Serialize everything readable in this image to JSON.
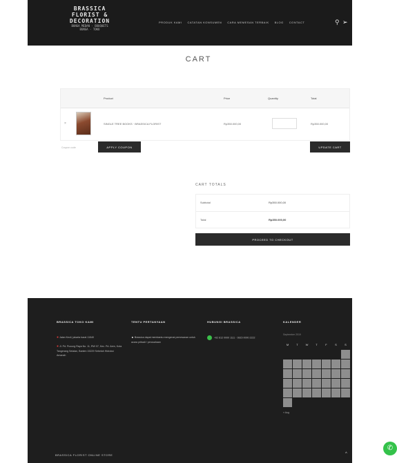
{
  "header": {
    "logo_lines": [
      "BRASSICA",
      "FLORIST &",
      "DECORATION"
    ],
    "logo_tagline": [
      "BUNGA MEDAN · BOUQUETS",
      "BUNGA · TOKO"
    ],
    "nav": [
      "PRODUK KAMI",
      "CATATAN KONSUMEN",
      "CARA MEMESAN TERBAIK",
      "BLOG",
      "CONTACT"
    ],
    "search_icon": "search-icon"
  },
  "page_title": "CART",
  "cart": {
    "columns": [
      "Product",
      "Price",
      "Quantity",
      "Total"
    ],
    "rows": [
      {
        "product": "SINGLE TREE BOOKS · BRASSICA FLORIST",
        "price": "Rp350.000,00",
        "total": "Rp350.000,00"
      }
    ],
    "coupon_placeholder": "Coupon code",
    "apply_label": "APPLY COUPON",
    "update_label": "UPDATE CART"
  },
  "totals": {
    "title": "CART TOTALS",
    "rows": [
      {
        "label": "Subtotal",
        "value": "Rp350.000,00"
      },
      {
        "label": "Total",
        "value": "Rp350.000,00"
      }
    ],
    "checkout_label": "PROCEED TO CHECKOUT"
  },
  "footer": {
    "col1": {
      "title": "BRASSICA TOKO KAMI",
      "lines": [
        "Jalan Kecil, jakarta barat 11540",
        "Jl. Pd. Pucung Raya No. 11, RW 07, Kec. Pd. Aren, Kota Tangerang Selatan, Banten 15229 Sebelah Hidroksi Amanah"
      ]
    },
    "col2": {
      "title": "TENTU PERTANYAAN",
      "lines": [
        "Brassica dapat membantu mengenai pemesanan untuk acara pribadi / perusahaan"
      ]
    },
    "col3": {
      "title": "HUBUNGI BRASSICA",
      "lines": [
        "+62 812 0000 1111 · 0815 0000 2222"
      ]
    },
    "col4": {
      "title": "KALENDER",
      "month": "September 2019",
      "days": [
        "M",
        "T",
        "W",
        "T",
        "F",
        "S",
        "S"
      ],
      "prev": "« Aug"
    },
    "bottom": "BRASSICA FLORIST ONLINE STORE",
    "up_arrow": "^"
  },
  "whatsapp_float": "whatsapp-icon"
}
